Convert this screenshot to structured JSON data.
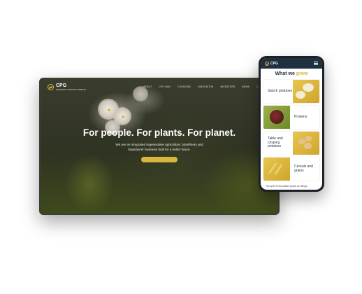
{
  "desktop": {
    "logo": "CPG",
    "logo_sub": "CENTURY PACIFIC GROUP",
    "nav": [
      "ABOUT",
      "CPG WAY",
      "DIVISIONS",
      "INNOVATION",
      "INVESTORS",
      "NEWS",
      "CONTACT"
    ],
    "hero_title": "For people. For plants. For planet.",
    "hero_desc": "We are an integrated regenerative agriculture, biorefinery and biopolymer business built for a better future.",
    "cta_label": ""
  },
  "mobile": {
    "logo": "CPG",
    "section_title_prefix": "What we ",
    "section_title_accent": "grow",
    "cards": [
      {
        "label": "Starch potatoes"
      },
      {
        "label": "Proteins"
      },
      {
        "label": "Table and crisping potatoes"
      },
      {
        "label": "Cereals and grains"
      }
    ],
    "footer": "The spirit of innovation grows as deeply"
  },
  "colors": {
    "accent": "#d8b63c",
    "navy": "#1f3140"
  }
}
